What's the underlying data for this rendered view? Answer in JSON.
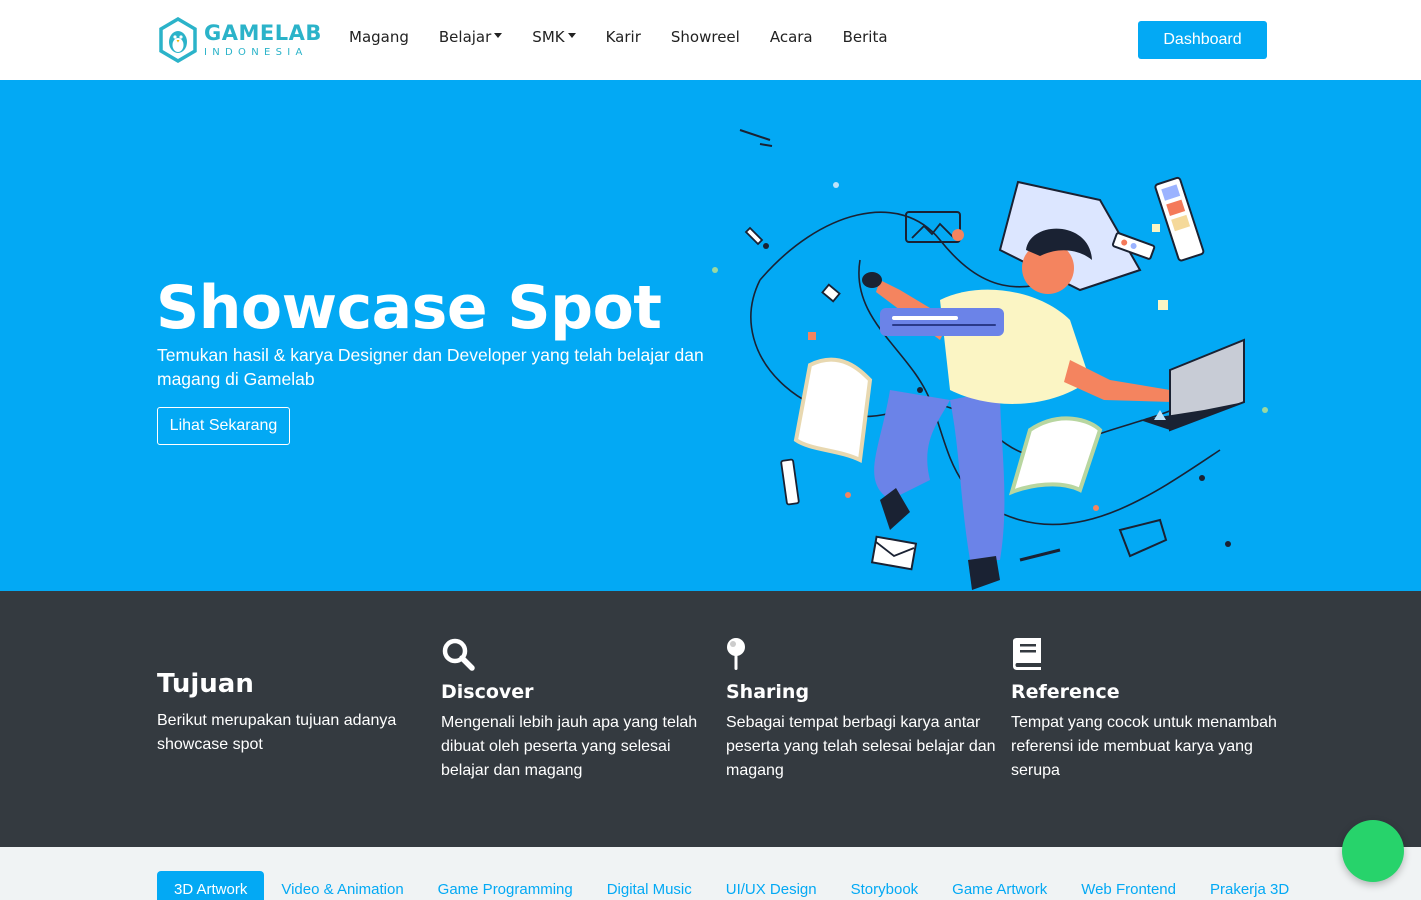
{
  "brand": {
    "name": "GAMELAB",
    "sub": "INDONESIA",
    "accent": "#03a9f4",
    "logo_color": "#2bb3c9"
  },
  "nav": {
    "items": [
      {
        "label": "Magang",
        "dropdown": false
      },
      {
        "label": "Belajar",
        "dropdown": true
      },
      {
        "label": "SMK",
        "dropdown": true
      },
      {
        "label": "Karir",
        "dropdown": false
      },
      {
        "label": "Showreel",
        "dropdown": false
      },
      {
        "label": "Acara",
        "dropdown": false
      },
      {
        "label": "Berita",
        "dropdown": false
      }
    ],
    "dashboard_label": "Dashboard"
  },
  "hero": {
    "title": "Showcase Spot",
    "subtitle": "Temukan hasil & karya Designer dan Developer yang telah belajar dan magang di Gamelab",
    "cta_label": "Lihat Sekarang",
    "background": "#03a9f4"
  },
  "goals": {
    "title": "Tujuan",
    "intro": "Berikut merupakan tujuan adanya showcase spot",
    "items": [
      {
        "icon": "search-icon",
        "title": "Discover",
        "text": "Mengenali lebih jauh apa yang telah dibuat oleh peserta yang selesai belajar dan magang"
      },
      {
        "icon": "pin-icon",
        "title": "Sharing",
        "text": "Sebagai tempat berbagi karya antar peserta yang telah selesai belajar dan magang"
      },
      {
        "icon": "book-icon",
        "title": "Reference",
        "text": "Tempat yang cocok untuk menambah referensi ide membuat karya yang serupa"
      }
    ]
  },
  "tabs": {
    "items": [
      "3D Artwork",
      "Video & Animation",
      "Game Programming",
      "Digital Music",
      "UI/UX Design",
      "Storybook",
      "Game Artwork",
      "Web Frontend",
      "Prakerja 3D"
    ],
    "active": "3D Artwork"
  },
  "chat_button": {
    "icon": "chat-icon",
    "color": "#27d36b"
  }
}
